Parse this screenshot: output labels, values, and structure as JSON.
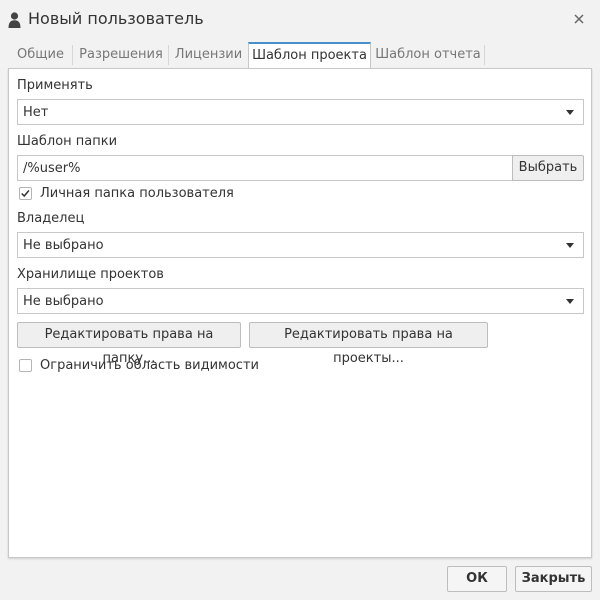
{
  "window": {
    "title": "Новый пользователь",
    "icon": "user-icon",
    "close_icon": "close-icon"
  },
  "tabs": [
    {
      "label": "Общие",
      "active": false
    },
    {
      "label": "Разрешения",
      "active": false
    },
    {
      "label": "Лицензии",
      "active": false
    },
    {
      "label": "Шаблон проекта",
      "active": true
    },
    {
      "label": "Шаблон отчета",
      "active": false
    }
  ],
  "form": {
    "apply": {
      "label": "Применять",
      "value": "Нет"
    },
    "folder_template": {
      "label": "Шаблон папки",
      "value": "/%user%",
      "browse_label": "Выбрать"
    },
    "personal_folder": {
      "label": "Личная папка пользователя",
      "checked": true
    },
    "owner": {
      "label": "Владелец",
      "value": "Не выбрано"
    },
    "project_storage": {
      "label": "Хранилище проектов",
      "value": "Не выбрано"
    },
    "edit_folder_rights_label": "Редактировать права на папку...",
    "edit_project_rights_label": "Редактировать права на проекты...",
    "restrict_visibility": {
      "label": "Ограничить область видимости",
      "checked": false
    }
  },
  "footer": {
    "ok_label": "ОК",
    "close_label": "Закрыть"
  },
  "colors": {
    "accent": "#4a90c8",
    "background": "#f2f2f2",
    "panel": "#ffffff"
  }
}
